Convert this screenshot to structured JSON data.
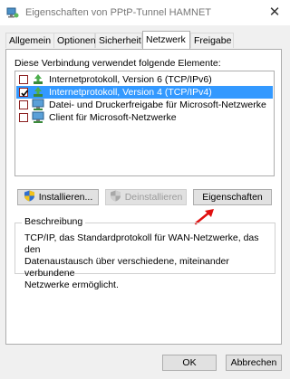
{
  "window": {
    "title": "Eigenschaften von PPtP-Tunnel HAMNET",
    "close_glyph": "✕"
  },
  "tabs": [
    {
      "label": "Allgemein",
      "active": false
    },
    {
      "label": "Optionen",
      "active": false
    },
    {
      "label": "Sicherheit",
      "active": false
    },
    {
      "label": "Netzwerk",
      "active": true
    },
    {
      "label": "Freigabe",
      "active": false
    }
  ],
  "connection": {
    "label": "Diese Verbindung verwendet folgende Elemente:",
    "items": [
      {
        "label": "Internetprotokoll, Version 6 (TCP/IPv6)",
        "checked": false,
        "selected": false,
        "icon": "network-protocol-icon"
      },
      {
        "label": "Internetprotokoll, Version 4 (TCP/IPv4)",
        "checked": true,
        "selected": true,
        "icon": "network-protocol-icon"
      },
      {
        "label": "Datei- und Druckerfreigabe für Microsoft-Netzwerke",
        "checked": false,
        "selected": false,
        "icon": "network-service-icon"
      },
      {
        "label": "Client für Microsoft-Netzwerke",
        "checked": false,
        "selected": false,
        "icon": "network-client-icon"
      }
    ]
  },
  "buttons": {
    "install": "Installieren...",
    "uninstall": "Deinstallieren",
    "properties": "Eigenschaften",
    "ok": "OK",
    "cancel": "Abbrechen"
  },
  "description": {
    "heading": "Beschreibung",
    "text": "TCP/IP, das Standardprotokoll für WAN-Netzwerke, das den\nDatenaustausch über verschiedene, miteinander verbundene\nNetzwerke ermöglicht."
  },
  "colors": {
    "selection": "#3399ff",
    "annotation_arrow": "#e01010"
  }
}
